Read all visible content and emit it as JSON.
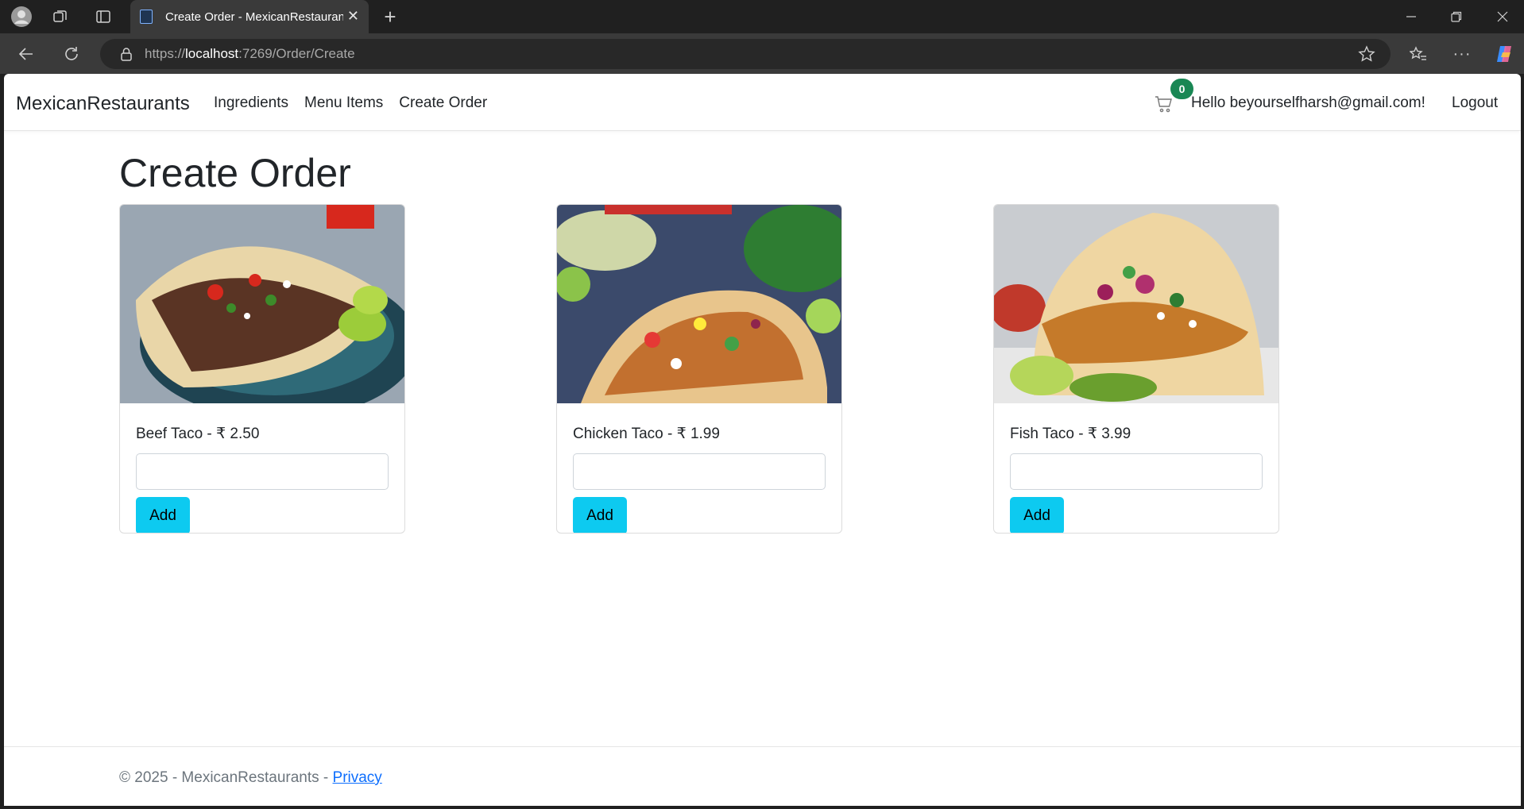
{
  "browser": {
    "tab_title": "Create Order - MexicanRestaurants",
    "url_scheme": "https://",
    "url_host": "localhost",
    "url_rest": ":7269/Order/Create"
  },
  "navbar": {
    "brand": "MexicanRestaurants",
    "links": [
      "Ingredients",
      "Menu Items",
      "Create Order"
    ],
    "cart_count": "0",
    "greeting": "Hello beyourselfharsh@gmail.com!",
    "logout": "Logout"
  },
  "page": {
    "title": "Create Order",
    "items": [
      {
        "label": "Beef Taco - ₹ 2.50",
        "button": "Add",
        "image": "beef-taco-photo"
      },
      {
        "label": "Chicken Taco - ₹ 1.99",
        "button": "Add",
        "image": "chicken-taco-photo"
      },
      {
        "label": "Fish Taco - ₹ 3.99",
        "button": "Add",
        "image": "fish-taco-photo"
      }
    ]
  },
  "footer": {
    "text": "© 2025 - MexicanRestaurants - ",
    "privacy": "Privacy"
  },
  "colors": {
    "accent_button": "#0dcaf0",
    "badge": "#198754",
    "link": "#0d6efd"
  }
}
